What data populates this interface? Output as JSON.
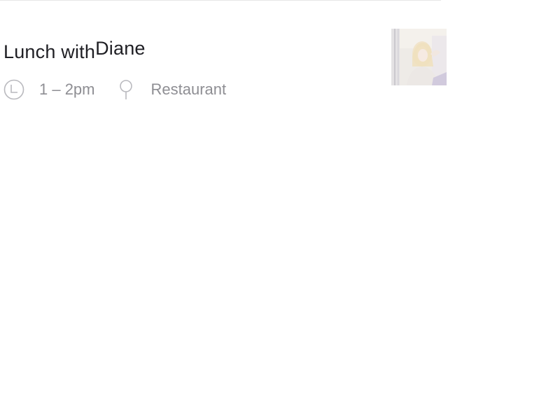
{
  "event": {
    "title_prefix": "Lunch with",
    "title_name": "Diane",
    "time": "1 – 2pm",
    "location": "Restaurant"
  },
  "icons": {
    "time": "clock-icon",
    "location": "map-pin-icon"
  },
  "avatar": {
    "person": "Diane"
  },
  "colors": {
    "title": "#1f1f24",
    "meta_text": "#8e8e93",
    "icon_stroke": "#b9b9be",
    "divider": "#e6e6e6",
    "background": "#ffffff"
  }
}
